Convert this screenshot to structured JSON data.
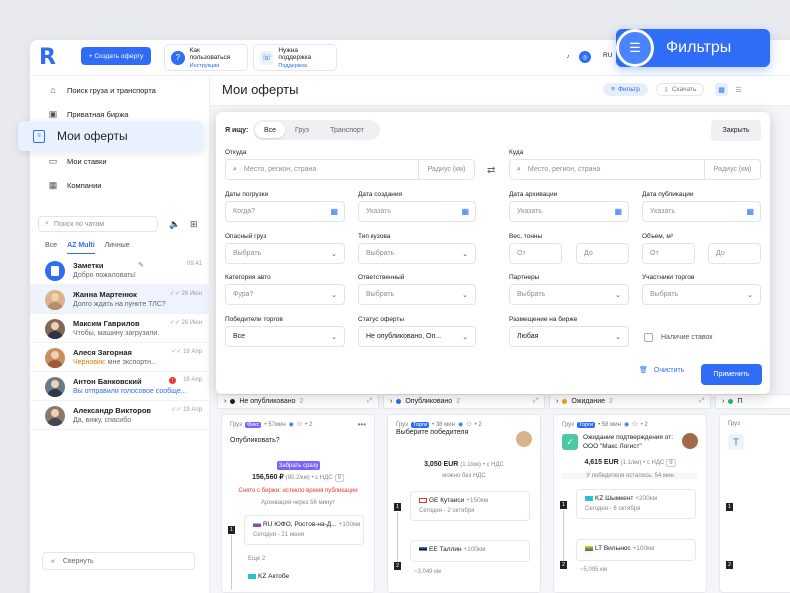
{
  "topbar": {
    "logo": "R",
    "create_button": "+ Создать оферту",
    "help1": {
      "title": "Как пользоваться",
      "sub": "Инструкции",
      "icon": "?"
    },
    "help2": {
      "title": "Нужна поддержка",
      "sub": "Поддержка",
      "icon": "☏"
    },
    "lang": "RU"
  },
  "sidebar": {
    "nav": [
      {
        "label": "Поиск груза и транспорта",
        "icon": "⌂"
      },
      {
        "label": "Приватная биржа",
        "icon": "🔒"
      },
      {
        "label": "Мои ставки",
        "icon": "▭"
      },
      {
        "label": "Компании",
        "icon": "▦"
      }
    ],
    "chat_search_placeholder": "Поиск по чатам",
    "chat_tabs": [
      "Все",
      "AZ Multi",
      "Личные"
    ],
    "chats": [
      {
        "name": "Заметки",
        "msg": "Добро пожаловать!",
        "time": "09:41",
        "pin": "✎"
      },
      {
        "name": "Жанна Мартенюк",
        "msg": "Долго ждать на пункте ТЛС?",
        "time": "✓✓ 26 Июн"
      },
      {
        "name": "Максим Гаврилов",
        "msg": "Чтобы, машину загрузили.",
        "time": "✓✓ 26 Июн"
      },
      {
        "name": "Алеся Загорная",
        "msg_prefix": "Черновик:",
        "msg": " мне экспортн...",
        "time": "✓✓ 19 Апр"
      },
      {
        "name": "Антон Банковский",
        "msg": "Вы отправили голосовое сообще...",
        "time": "19 Апр"
      },
      {
        "name": "Александр Викторов",
        "msg": "Да, вижу, спасибо",
        "time": "✓✓ 19 Апр"
      }
    ],
    "collapse_label": "Свернуть"
  },
  "highlight_label": "Мои оферты",
  "filters_badge": "Фильтры",
  "main": {
    "title": "Мои оферты",
    "filter_pill": "Фильтр",
    "download_pill": "Скачать"
  },
  "filter_panel": {
    "seek_label": "Я ищу:",
    "seek_tabs": [
      "Все",
      "Груз",
      "Транспорт"
    ],
    "close": "Закрыть",
    "from_label": "Откуда",
    "to_label": "Куда",
    "place_placeholder": "Место, регион, страна",
    "radius": "Радиус (км)",
    "load_dates": "Даты погрузки",
    "created": "Дата создания",
    "archived": "Дата архивации",
    "published": "Дата публикации",
    "when": "Когда?",
    "specify": "Указать",
    "danger": "Опасный груз",
    "body_type": "Тип кузова",
    "weight": "Вес, тонны",
    "volume": "Объем, м³",
    "choose": "Выбрать",
    "from": "От",
    "to": "До",
    "auto_cat": "Категория авто",
    "responsible": "Ответственный",
    "partners": "Партнеры",
    "participants": "Участники торгов",
    "truck": "Фура?",
    "winners": "Победители торгов",
    "offer_status": "Статус оферты",
    "placement": "Размещение на бирже",
    "all": "Все",
    "status_value": "Не опубликовано, Оп...",
    "any": "Любая",
    "has_bids": "Наличие ставок",
    "clear": "Очистить",
    "apply": "Применить"
  },
  "kanban": {
    "columns": [
      {
        "title": "Не опубликовано",
        "count": "2",
        "color": "#222"
      },
      {
        "title": "Опубликовано",
        "count": "2",
        "color": "#2f6df6"
      },
      {
        "title": "Ожидание",
        "count": "2",
        "color": "#f0a020"
      },
      {
        "title": "П",
        "count": "",
        "color": "#2bb673"
      }
    ],
    "cards": [
      {
        "type": "Груз",
        "tag": "Фикс",
        "tag_color": "#7b61ff",
        "age": "• 57мин",
        "bids": "• 2",
        "status": "Опубликовать?",
        "chip": "Забрать сразу",
        "price": "156,560 ₽",
        "price_sub": "(80.2/км) • с НДС",
        "price_badge": "9",
        "note": "Снято с биржи: истекло время публикации",
        "note2": "Архивация через 56 минут",
        "route1": {
          "flag": "RU",
          "l1": "ЮФО, Ростов-на-Д...",
          "dist": "+100км",
          "l2": "Сегодня - 21 июня"
        },
        "more_stops": "Еще 2",
        "route2": {
          "flag": "KZ",
          "l1": "Актобе"
        }
      },
      {
        "type": "Груз",
        "tag": "Торги",
        "tag_color": "#2f6df6",
        "age": "• 38 мин",
        "bids": "• 2",
        "status": "Выберите победителя",
        "price": "3,050 EUR",
        "price_sub": "(1.1/км) • с НДС",
        "note2": "можно без НДС",
        "route1": {
          "flag": "GE",
          "l1": "Кутаиси",
          "dist": "+150км",
          "l2": "Сегодня - 2 октября"
        },
        "route2": {
          "flag": "EE",
          "l1": "Таллин",
          "dist": "+100км"
        },
        "dist": "~3,049 км"
      },
      {
        "type": "Груз",
        "tag": "Торги",
        "tag_color": "#2f6df6",
        "age": "• 58 мин",
        "bids": "• 2",
        "status": "Ожидание подтверждения от:",
        "status2": "ООО \"Макс Логист\"",
        "price": "4,615 EUR",
        "price_sub": "(1.1/км) • с НДС",
        "price_badge": "9",
        "note2": "У победителя осталось: 54 мин",
        "route1": {
          "flag": "KZ",
          "l1": "Шымкент",
          "dist": "+200км",
          "l2": "Сегодня - 6 октября"
        },
        "route2": {
          "flag": "LT",
          "l1": "Вильнюс",
          "dist": "+100км"
        },
        "dist": "~5,095 км"
      }
    ]
  }
}
